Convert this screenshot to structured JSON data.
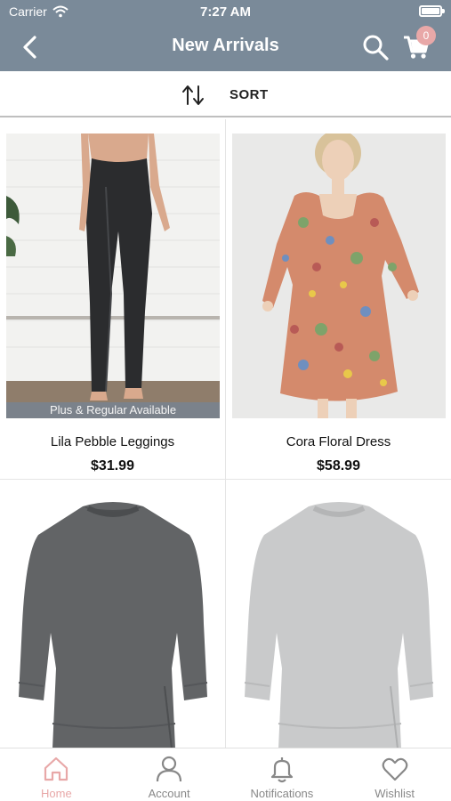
{
  "status_bar": {
    "carrier": "Carrier",
    "time": "7:27 AM"
  },
  "nav": {
    "title": "New Arrivals",
    "cart_count": "0"
  },
  "sort": {
    "label": "SORT"
  },
  "products": [
    {
      "name": "Lila Pebble Leggings",
      "price": "$31.99",
      "banner": "Plus & Regular Available"
    },
    {
      "name": "Cora Floral Dress",
      "price": "$58.99"
    },
    {
      "name": "",
      "price": ""
    },
    {
      "name": "",
      "price": ""
    }
  ],
  "tabs": [
    {
      "label": "Home",
      "icon": "home-icon",
      "active": true
    },
    {
      "label": "Account",
      "icon": "user-icon",
      "active": false
    },
    {
      "label": "Notifications",
      "icon": "bell-icon",
      "active": false
    },
    {
      "label": "Wishlist",
      "icon": "heart-icon",
      "active": false
    }
  ],
  "colors": {
    "header": "#7a8a99",
    "accent": "#e8a8a8",
    "tab_inactive": "#888888"
  }
}
